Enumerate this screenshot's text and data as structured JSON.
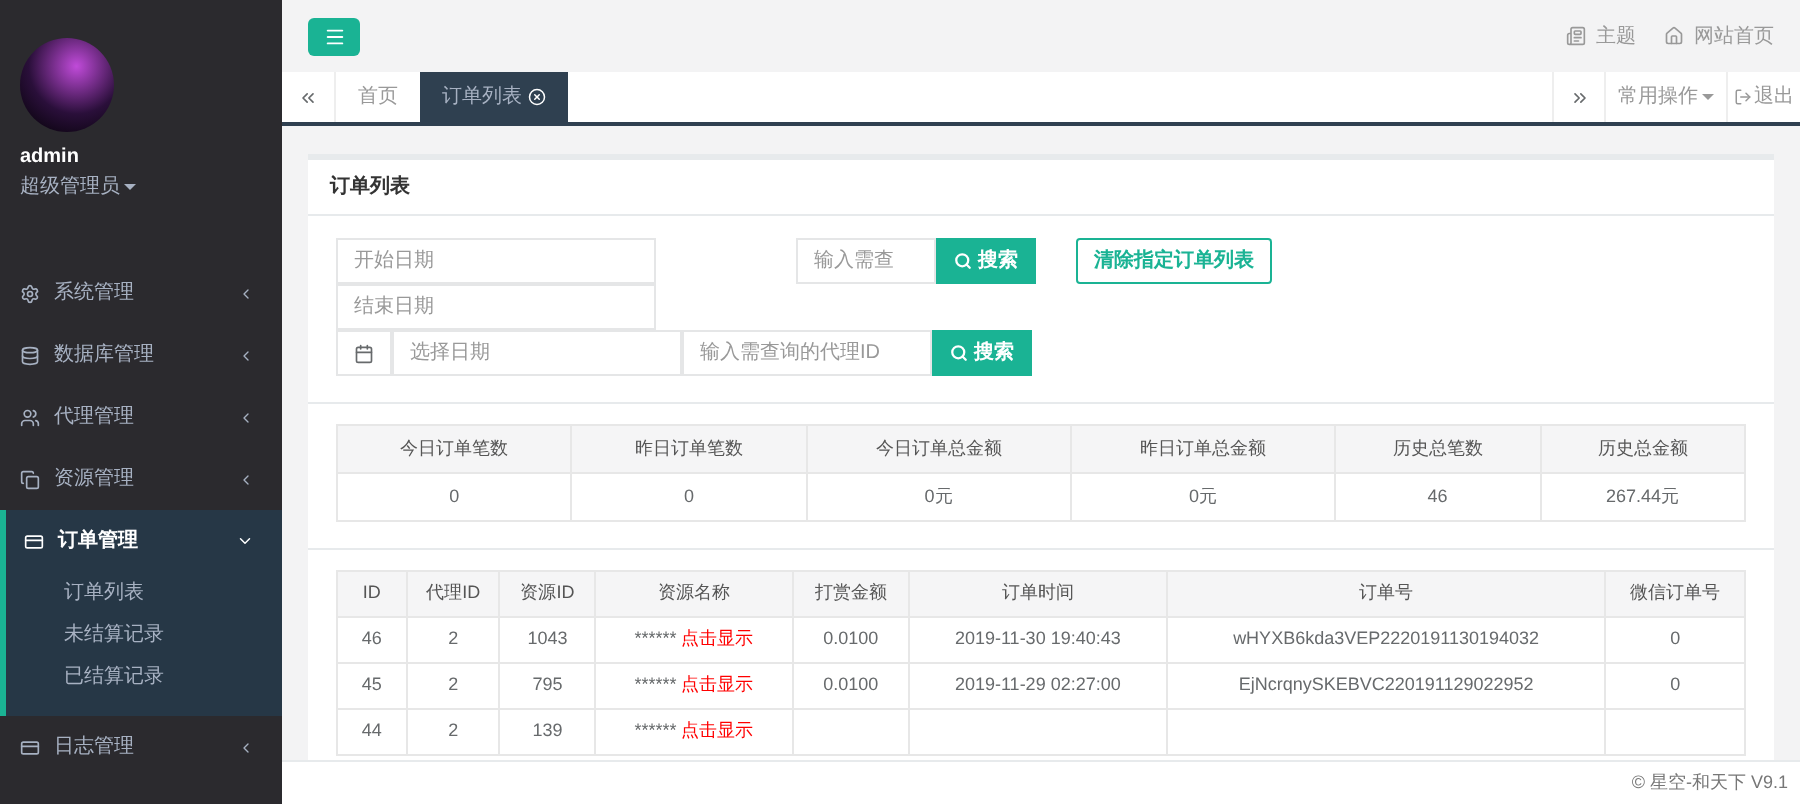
{
  "sidebar": {
    "user": {
      "name": "admin",
      "role": "超级管理员"
    },
    "menu": [
      {
        "label": "系统管理",
        "expanded": false
      },
      {
        "label": "数据库管理",
        "expanded": false
      },
      {
        "label": "代理管理",
        "expanded": false
      },
      {
        "label": "资源管理",
        "expanded": false
      },
      {
        "label": "订单管理",
        "expanded": true,
        "children": [
          {
            "label": "订单列表"
          },
          {
            "label": "未结算记录"
          },
          {
            "label": "已结算记录"
          }
        ]
      },
      {
        "label": "日志管理",
        "expanded": false
      }
    ]
  },
  "topbar": {
    "links": [
      {
        "label": "主题"
      },
      {
        "label": "网站首页"
      }
    ]
  },
  "tabs": [
    {
      "label": "首页",
      "selected": false,
      "closable": false
    },
    {
      "label": "订单列表",
      "selected": true,
      "closable": true
    }
  ],
  "tab_actions": {
    "menu": "常用操作",
    "logout": "退出"
  },
  "panel": {
    "title": "订单列表",
    "start_date": {
      "placeholder": "开始日期"
    },
    "end_date": {
      "placeholder": "结束日期"
    },
    "order_search": {
      "placeholder": "输入需查",
      "button": "搜索"
    },
    "clear_button": "清除指定订单列表",
    "date_pick": {
      "placeholder": "选择日期"
    },
    "agent_search": {
      "placeholder": "输入需查询的代理ID",
      "button": "搜索"
    },
    "stats": {
      "columns": [
        "今日订单笔数",
        "昨日订单笔数",
        "今日订单总金额",
        "昨日订单总金额",
        "历史总笔数",
        "历史总金额"
      ],
      "values": [
        "0",
        "0",
        "0元",
        "0元",
        "46",
        "267.44元"
      ]
    },
    "orders": {
      "columns": [
        "ID",
        "代理ID",
        "资源ID",
        "资源名称",
        "打赏金额",
        "订单时间",
        "订单号",
        "微信订单号"
      ],
      "rows": [
        {
          "id": "46",
          "agent": "2",
          "resource": "1043",
          "masked": "******",
          "reveal": "点击显示",
          "amount": "0.0100",
          "time": "2019-11-30 19:40:43",
          "order_no": "wHYXB6kda3VEP2220191130194032",
          "wx_no": "0"
        },
        {
          "id": "45",
          "agent": "2",
          "resource": "795",
          "masked": "******",
          "reveal": "点击显示",
          "amount": "0.0100",
          "time": "2019-11-29 02:27:00",
          "order_no": "EjNcrqnySKEBVC220191129022952",
          "wx_no": "0"
        },
        {
          "id": "44",
          "agent": "2",
          "resource": "139",
          "masked": "******",
          "reveal": "点击显示"
        }
      ]
    }
  },
  "footer": "© 星空-和天下 V9.1"
}
